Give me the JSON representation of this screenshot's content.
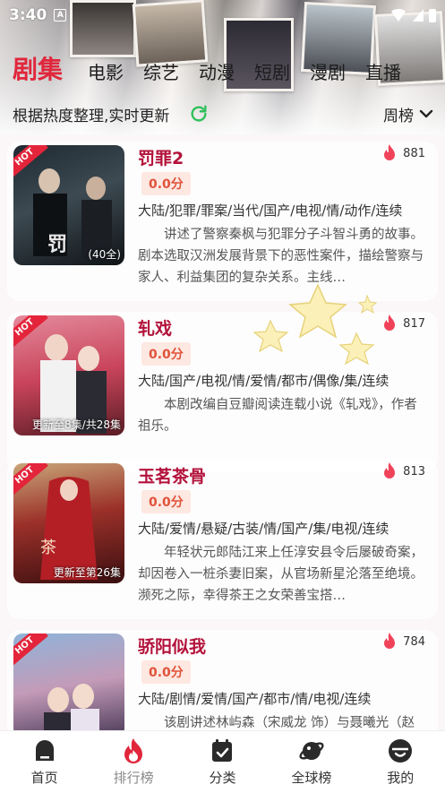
{
  "status_bar": {
    "time": "3:40",
    "badge": "A"
  },
  "tabs": [
    "剧集",
    "电影",
    "综艺",
    "动漫",
    "短剧",
    "漫剧",
    "直播"
  ],
  "active_tab": 0,
  "subbar": {
    "text": "根据热度整理,实时更新",
    "sort_label": "周榜"
  },
  "items": [
    {
      "title": "罚罪2",
      "score": "0.0分",
      "heat": "881",
      "tags": "大陆/犯罪/罪案/当代/国产/电视/情/动作/连续",
      "desc": "讲述了警察秦枫与犯罪分子斗智斗勇的故事。剧本选取汉洲发展背景下的恶性案件，描绘警察与家人、利益集团的复杂关系。主线…",
      "poster_caption": "(40全)"
    },
    {
      "title": "轧戏",
      "score": "0.0分",
      "heat": "817",
      "tags": "大陆/国产/电视/情/爱情/都市/偶像/集/连续",
      "desc": "本剧改编自豆瓣阅读连载小说《轧戏》，作者祖乐。",
      "poster_caption": "更新至8集/共28集"
    },
    {
      "title": "玉茗茶骨",
      "score": "0.0分",
      "heat": "813",
      "tags": "大陆/爱情/悬疑/古装/情/国产/集/电视/连续",
      "desc": "年轻状元郎陆江来上任淳安县令后屡破奇案，却因卷入一桩杀妻旧案，从官场新星沦落至绝境。濒死之际，幸得茶王之女荣善宝搭…",
      "poster_caption": "更新至第26集"
    },
    {
      "title": "骄阳似我",
      "score": "0.0分",
      "heat": "784",
      "tags": "大陆/剧情/爱情/国产/都市/情/电视/连续",
      "desc": "该剧讲述林屿森（宋威龙 饰）与聂曦光（赵",
      "poster_caption": ""
    }
  ],
  "hot_label": "HOT",
  "bottom_nav": [
    {
      "label": "首页",
      "icon": "home-icon"
    },
    {
      "label": "排行榜",
      "icon": "fire-icon"
    },
    {
      "label": "分类",
      "icon": "calendar-icon"
    },
    {
      "label": "全球榜",
      "icon": "planet-icon"
    },
    {
      "label": "我的",
      "icon": "profile-icon"
    }
  ],
  "colors": {
    "accent": "#e0263b",
    "title": "#b3123b",
    "score_bg": "#fde8e2",
    "refresh": "#2fbf5a"
  }
}
